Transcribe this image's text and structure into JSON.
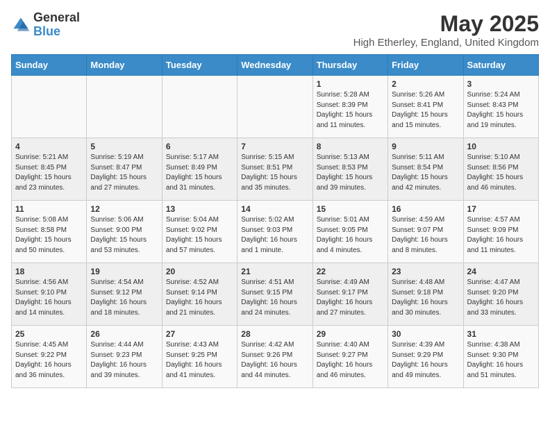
{
  "logo": {
    "general": "General",
    "blue": "Blue"
  },
  "title": "May 2025",
  "subtitle": "High Etherley, England, United Kingdom",
  "headers": [
    "Sunday",
    "Monday",
    "Tuesday",
    "Wednesday",
    "Thursday",
    "Friday",
    "Saturday"
  ],
  "weeks": [
    [
      {
        "day": "",
        "info": ""
      },
      {
        "day": "",
        "info": ""
      },
      {
        "day": "",
        "info": ""
      },
      {
        "day": "",
        "info": ""
      },
      {
        "day": "1",
        "info": "Sunrise: 5:28 AM\nSunset: 8:39 PM\nDaylight: 15 hours\nand 11 minutes."
      },
      {
        "day": "2",
        "info": "Sunrise: 5:26 AM\nSunset: 8:41 PM\nDaylight: 15 hours\nand 15 minutes."
      },
      {
        "day": "3",
        "info": "Sunrise: 5:24 AM\nSunset: 8:43 PM\nDaylight: 15 hours\nand 19 minutes."
      }
    ],
    [
      {
        "day": "4",
        "info": "Sunrise: 5:21 AM\nSunset: 8:45 PM\nDaylight: 15 hours\nand 23 minutes."
      },
      {
        "day": "5",
        "info": "Sunrise: 5:19 AM\nSunset: 8:47 PM\nDaylight: 15 hours\nand 27 minutes."
      },
      {
        "day": "6",
        "info": "Sunrise: 5:17 AM\nSunset: 8:49 PM\nDaylight: 15 hours\nand 31 minutes."
      },
      {
        "day": "7",
        "info": "Sunrise: 5:15 AM\nSunset: 8:51 PM\nDaylight: 15 hours\nand 35 minutes."
      },
      {
        "day": "8",
        "info": "Sunrise: 5:13 AM\nSunset: 8:53 PM\nDaylight: 15 hours\nand 39 minutes."
      },
      {
        "day": "9",
        "info": "Sunrise: 5:11 AM\nSunset: 8:54 PM\nDaylight: 15 hours\nand 42 minutes."
      },
      {
        "day": "10",
        "info": "Sunrise: 5:10 AM\nSunset: 8:56 PM\nDaylight: 15 hours\nand 46 minutes."
      }
    ],
    [
      {
        "day": "11",
        "info": "Sunrise: 5:08 AM\nSunset: 8:58 PM\nDaylight: 15 hours\nand 50 minutes."
      },
      {
        "day": "12",
        "info": "Sunrise: 5:06 AM\nSunset: 9:00 PM\nDaylight: 15 hours\nand 53 minutes."
      },
      {
        "day": "13",
        "info": "Sunrise: 5:04 AM\nSunset: 9:02 PM\nDaylight: 15 hours\nand 57 minutes."
      },
      {
        "day": "14",
        "info": "Sunrise: 5:02 AM\nSunset: 9:03 PM\nDaylight: 16 hours\nand 1 minute."
      },
      {
        "day": "15",
        "info": "Sunrise: 5:01 AM\nSunset: 9:05 PM\nDaylight: 16 hours\nand 4 minutes."
      },
      {
        "day": "16",
        "info": "Sunrise: 4:59 AM\nSunset: 9:07 PM\nDaylight: 16 hours\nand 8 minutes."
      },
      {
        "day": "17",
        "info": "Sunrise: 4:57 AM\nSunset: 9:09 PM\nDaylight: 16 hours\nand 11 minutes."
      }
    ],
    [
      {
        "day": "18",
        "info": "Sunrise: 4:56 AM\nSunset: 9:10 PM\nDaylight: 16 hours\nand 14 minutes."
      },
      {
        "day": "19",
        "info": "Sunrise: 4:54 AM\nSunset: 9:12 PM\nDaylight: 16 hours\nand 18 minutes."
      },
      {
        "day": "20",
        "info": "Sunrise: 4:52 AM\nSunset: 9:14 PM\nDaylight: 16 hours\nand 21 minutes."
      },
      {
        "day": "21",
        "info": "Sunrise: 4:51 AM\nSunset: 9:15 PM\nDaylight: 16 hours\nand 24 minutes."
      },
      {
        "day": "22",
        "info": "Sunrise: 4:49 AM\nSunset: 9:17 PM\nDaylight: 16 hours\nand 27 minutes."
      },
      {
        "day": "23",
        "info": "Sunrise: 4:48 AM\nSunset: 9:18 PM\nDaylight: 16 hours\nand 30 minutes."
      },
      {
        "day": "24",
        "info": "Sunrise: 4:47 AM\nSunset: 9:20 PM\nDaylight: 16 hours\nand 33 minutes."
      }
    ],
    [
      {
        "day": "25",
        "info": "Sunrise: 4:45 AM\nSunset: 9:22 PM\nDaylight: 16 hours\nand 36 minutes."
      },
      {
        "day": "26",
        "info": "Sunrise: 4:44 AM\nSunset: 9:23 PM\nDaylight: 16 hours\nand 39 minutes."
      },
      {
        "day": "27",
        "info": "Sunrise: 4:43 AM\nSunset: 9:25 PM\nDaylight: 16 hours\nand 41 minutes."
      },
      {
        "day": "28",
        "info": "Sunrise: 4:42 AM\nSunset: 9:26 PM\nDaylight: 16 hours\nand 44 minutes."
      },
      {
        "day": "29",
        "info": "Sunrise: 4:40 AM\nSunset: 9:27 PM\nDaylight: 16 hours\nand 46 minutes."
      },
      {
        "day": "30",
        "info": "Sunrise: 4:39 AM\nSunset: 9:29 PM\nDaylight: 16 hours\nand 49 minutes."
      },
      {
        "day": "31",
        "info": "Sunrise: 4:38 AM\nSunset: 9:30 PM\nDaylight: 16 hours\nand 51 minutes."
      }
    ]
  ]
}
